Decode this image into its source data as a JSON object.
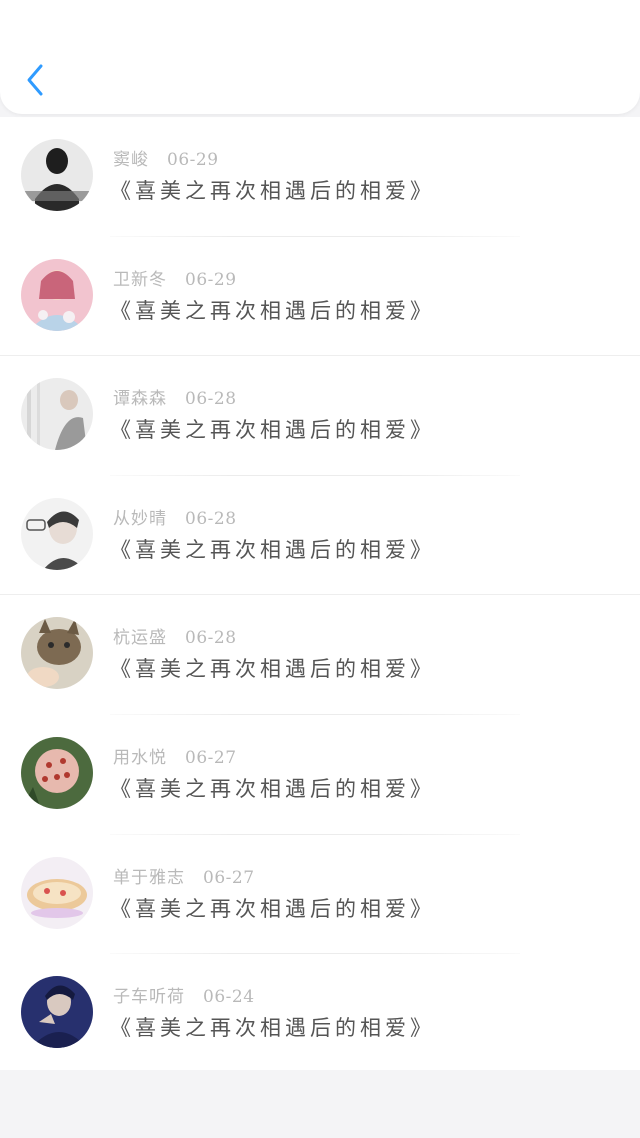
{
  "header": {
    "back_icon": "chevron-left-icon",
    "accent": "#2f9bff"
  },
  "items": [
    {
      "name": "窦峻",
      "date": "06-29",
      "title": "《喜美之再次相遇后的相爱》"
    },
    {
      "name": "卫新冬",
      "date": "06-29",
      "title": "《喜美之再次相遇后的相爱》"
    },
    {
      "name": "谭森森",
      "date": "06-28",
      "title": "《喜美之再次相遇后的相爱》"
    },
    {
      "name": "从妙晴",
      "date": "06-28",
      "title": "《喜美之再次相遇后的相爱》"
    },
    {
      "name": "杭运盛",
      "date": "06-28",
      "title": "《喜美之再次相遇后的相爱》"
    },
    {
      "name": "用水悦",
      "date": "06-27",
      "title": "《喜美之再次相遇后的相爱》"
    },
    {
      "name": "单于雅志",
      "date": "06-27",
      "title": "《喜美之再次相遇后的相爱》"
    },
    {
      "name": "子车听荷",
      "date": "06-24",
      "title": "《喜美之再次相遇后的相爱》"
    }
  ]
}
